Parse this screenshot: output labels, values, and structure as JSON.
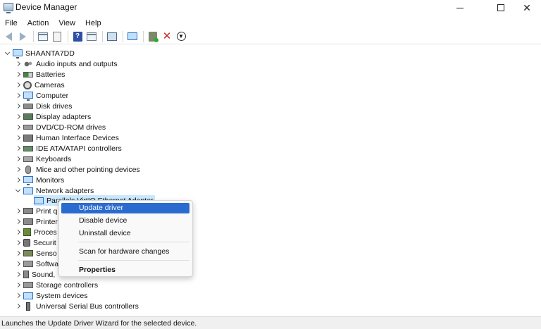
{
  "window": {
    "title": "Device Manager",
    "controls": {
      "minimize": "minimize-icon",
      "maximize": "maximize-icon",
      "close": "✕"
    }
  },
  "menu": [
    "File",
    "Action",
    "View",
    "Help"
  ],
  "toolbar": {
    "icons": [
      "back-arrow-icon",
      "forward-arrow-icon",
      "show-hide-console-tree-icon",
      "properties-icon",
      "help-icon",
      "action-pane-icon",
      "print-icon",
      "scan-hardware-icon",
      "add-driver-icon",
      "uninstall-icon",
      "update-driver-icon"
    ]
  },
  "tree": {
    "root": "SHAANTA7DD",
    "categories": [
      {
        "label": "Audio inputs and outputs",
        "icon": "speaker-icon"
      },
      {
        "label": "Batteries",
        "icon": "battery-icon"
      },
      {
        "label": "Cameras",
        "icon": "camera-icon"
      },
      {
        "label": "Computer",
        "icon": "computer-icon"
      },
      {
        "label": "Disk drives",
        "icon": "disk-drive-icon"
      },
      {
        "label": "Display adapters",
        "icon": "display-adapter-icon"
      },
      {
        "label": "DVD/CD-ROM drives",
        "icon": "dvd-drive-icon"
      },
      {
        "label": "Human Interface Devices",
        "icon": "hid-icon"
      },
      {
        "label": "IDE ATA/ATAPI controllers",
        "icon": "ide-controller-icon"
      },
      {
        "label": "Keyboards",
        "icon": "keyboard-icon"
      },
      {
        "label": "Mice and other pointing devices",
        "icon": "mouse-icon"
      },
      {
        "label": "Monitors",
        "icon": "monitor-icon"
      },
      {
        "label": "Network adapters",
        "icon": "network-adapter-icon",
        "expanded": true
      },
      {
        "label": "Parallels VirtIO Ethernet Adapter",
        "icon": "network-adapter-icon",
        "child": true,
        "selected": true
      },
      {
        "label": "Print q",
        "icon": "printer-icon"
      },
      {
        "label": "Printer",
        "icon": "printer-icon"
      },
      {
        "label": "Proces",
        "icon": "processor-icon"
      },
      {
        "label": "Securit",
        "icon": "security-icon"
      },
      {
        "label": "Senso",
        "icon": "sensor-icon"
      },
      {
        "label": "Softwa",
        "icon": "software-icon"
      },
      {
        "label": "Sound,",
        "icon": "sound-icon"
      },
      {
        "label": "Storage controllers",
        "icon": "storage-icon"
      },
      {
        "label": "System devices",
        "icon": "system-icon"
      },
      {
        "label": "Universal Serial Bus controllers",
        "icon": "usb-icon"
      }
    ]
  },
  "context_menu": {
    "items": [
      {
        "label": "Update driver",
        "highlighted": true
      },
      {
        "label": "Disable device"
      },
      {
        "label": "Uninstall device"
      },
      {
        "label": "Scan for hardware changes"
      },
      {
        "label": "Properties",
        "bold": true
      }
    ]
  },
  "status": "Launches the Update Driver Wizard for the selected device."
}
